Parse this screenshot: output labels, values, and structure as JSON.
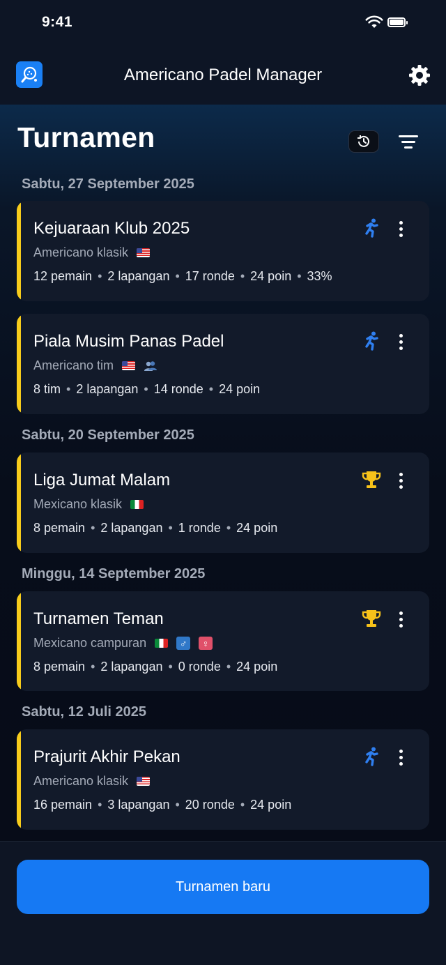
{
  "status_bar": {
    "time": "9:41"
  },
  "app_bar": {
    "title": "Americano Padel Manager"
  },
  "page": {
    "title": "Turnamen"
  },
  "groups": [
    {
      "date": "Sabtu, 27 September 2025",
      "cards": [
        {
          "title": "Kejuaraan Klub 2025",
          "format": "Americano klasik",
          "flag": "us",
          "status": "running",
          "meta": [
            "12 pemain",
            "2 lapangan",
            "17 ronde",
            "24 poin",
            "33%"
          ]
        },
        {
          "title": "Piala Musim Panas Padel",
          "format": "Americano tim",
          "flag": "us",
          "status": "running",
          "meta": [
            "8 tim",
            "2 lapangan",
            "14 ronde",
            "24 poin"
          ]
        }
      ]
    },
    {
      "date": "Sabtu, 20 September 2025",
      "cards": [
        {
          "title": "Liga Jumat Malam",
          "format": "Mexicano klasik",
          "flag": "mx",
          "status": "finished",
          "meta": [
            "8 pemain",
            "2 lapangan",
            "1 ronde",
            "24 poin"
          ]
        }
      ]
    },
    {
      "date": "Minggu, 14 September 2025",
      "cards": [
        {
          "title": "Turnamen Teman",
          "format": "Mexicano campuran",
          "flag": "mx",
          "status": "finished",
          "meta": [
            "8 pemain",
            "2 lapangan",
            "0 ronde",
            "24 poin"
          ]
        }
      ]
    },
    {
      "date": "Sabtu, 12 Juli 2025",
      "cards": [
        {
          "title": "Prajurit Akhir Pekan",
          "format": "Americano klasik",
          "flag": "us",
          "status": "running",
          "meta": [
            "16 pemain",
            "3 lapangan",
            "20 ronde",
            "24 poin"
          ]
        }
      ]
    }
  ],
  "bottom": {
    "new_button": "Turnamen baru"
  },
  "colors": {
    "accent": "#f7cc1b",
    "primary": "#1679f3",
    "running_icon": "#2f7ff0",
    "trophy": "#f7c21a"
  },
  "icons": {
    "running": "running-person-icon",
    "finished": "trophy-icon"
  }
}
